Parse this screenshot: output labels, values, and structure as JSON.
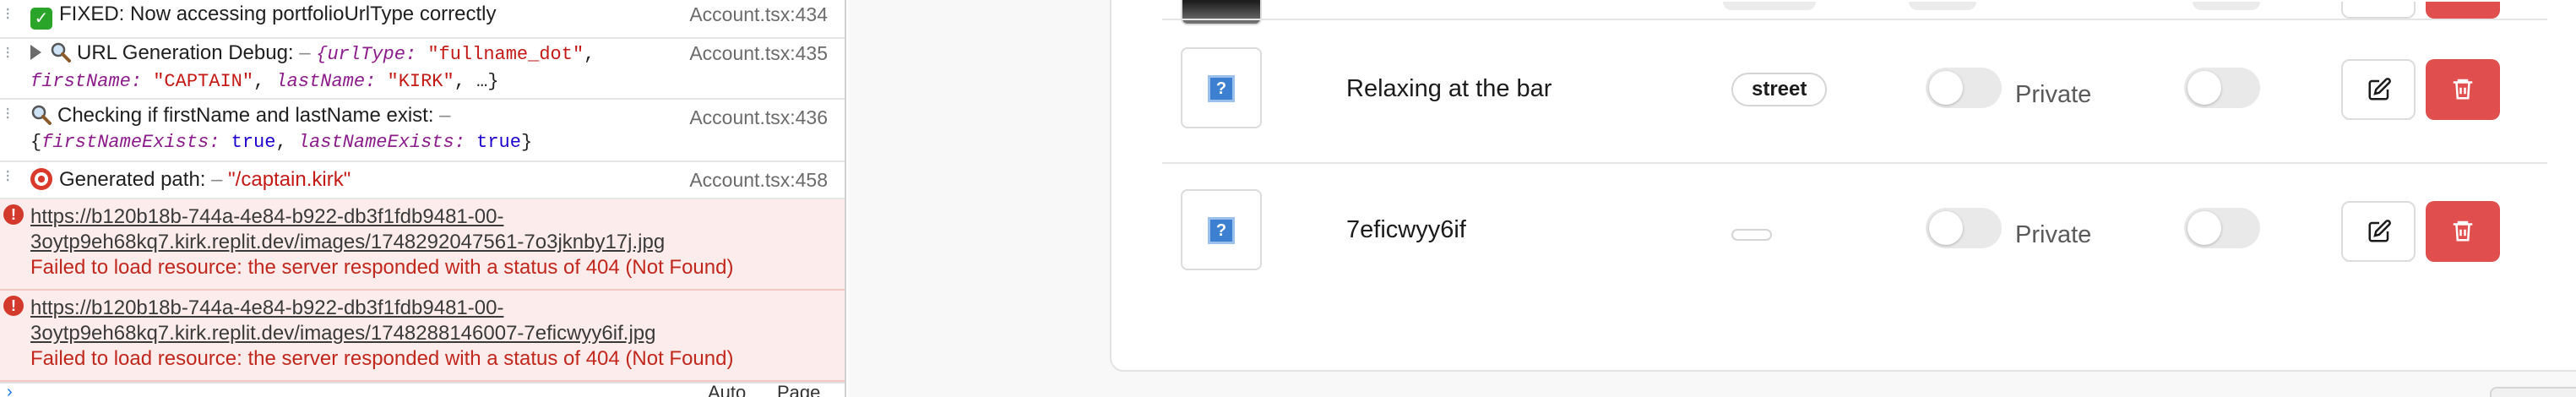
{
  "console": {
    "logs": [
      {
        "text": "FIXED: Now accessing portfolioUrlType correctly",
        "source": "Account.tsx:434"
      },
      {
        "label": "URL Generation Debug:",
        "sep": " – ",
        "obj_open": "{",
        "k1": "urlType",
        "v1": "\"fullname_dot\"",
        "k2": "firstName",
        "v2": "\"CAPTAIN\"",
        "k3": "lastName",
        "v3": "\"KIRK\"",
        "obj_close": ", …}",
        "source": "Account.tsx:435"
      },
      {
        "label": "Checking if firstName and lastName exist:",
        "sep": " –",
        "k1": "firstNameExists",
        "v1": "true",
        "k2": "lastNameExists",
        "v2": "true",
        "source": "Account.tsx:436"
      },
      {
        "label": "Generated path:",
        "sep": " – ",
        "value": "\"/captain.kirk\"",
        "source": "Account.tsx:458"
      }
    ],
    "errors": [
      {
        "url_line1": "https://b120b18b-744a-4e84-b922-db3f1fdb9481-00-",
        "url_line2": "3oytp9eh68kq7.kirk.replit.dev/images/1748292047561-7o3jknby17j.jpg",
        "message": "Failed to load resource: the server responded with a status of 404 (Not Found)"
      },
      {
        "url_line1": "https://b120b18b-744a-4e84-b922-db3f1fdb9481-00-",
        "url_line2": "3oytp9eh68kq7.kirk.replit.dev/images/1748288146007-7eficwyy6if.jpg",
        "message": "Failed to load resource: the server responded with a status of 404 (Not Found)"
      }
    ],
    "footer": {
      "auto": "Auto",
      "page": "Page"
    }
  },
  "portfolio": {
    "rows": [
      {
        "title": "Relaxing at the bar",
        "tag": "street",
        "visibility": "Private"
      },
      {
        "title": "7eficwyy6if",
        "tag": "",
        "visibility": "Private"
      }
    ]
  },
  "colors": {
    "delete": "#e04e4e",
    "error_bg": "#fdecec",
    "error_text": "#c1271d",
    "link": "#1a73e8"
  },
  "icons": [
    "check-icon",
    "magnifier-icon",
    "target-icon",
    "error-icon",
    "broken-image-icon",
    "edit-icon",
    "trash-icon",
    "disclosure-triangle-icon"
  ]
}
